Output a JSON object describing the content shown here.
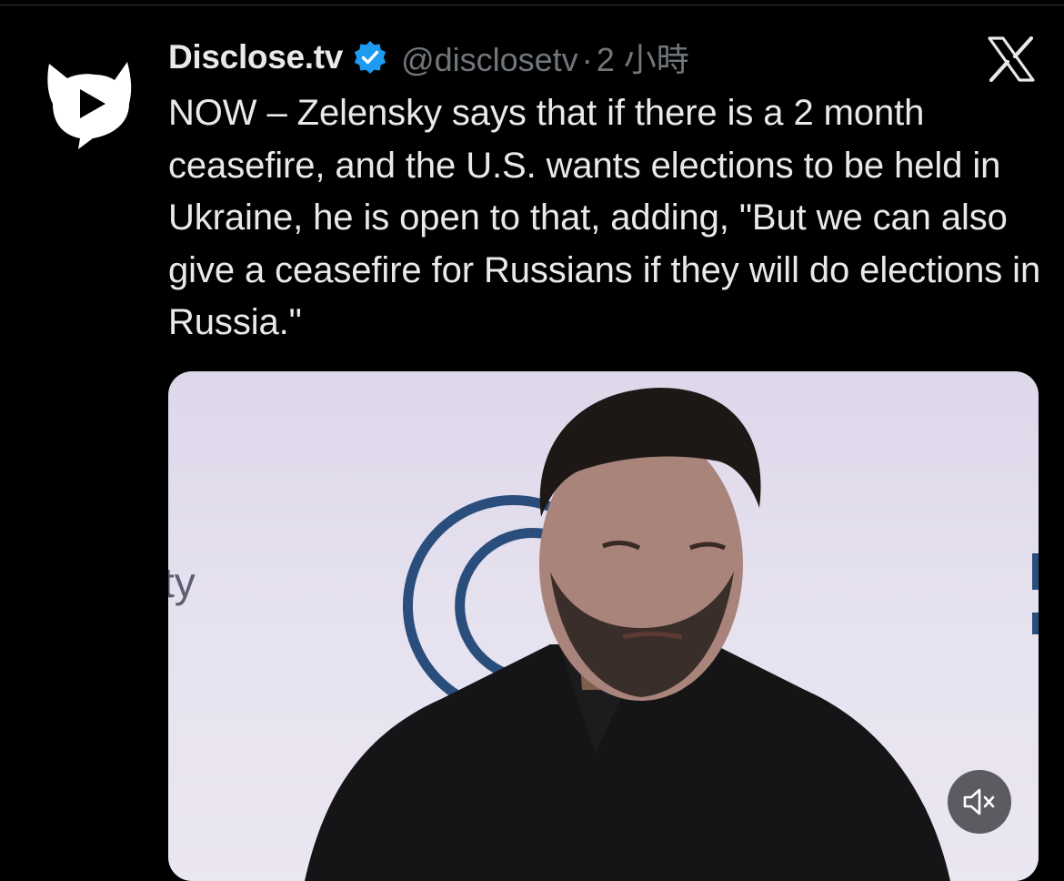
{
  "tweet": {
    "display_name": "Disclose.tv",
    "handle": "@disclosetv",
    "separator": "·",
    "time": "2 小時",
    "text": "NOW – Zelensky says that if there is a 2 month ceasefire, and the U.S. wants elections to be held in Ukraine, he is open to that, adding, \"But we can also give a ceasefire for Russians if they will do elections in Russia.\""
  },
  "media": {
    "backdrop_text": "ty"
  },
  "icons": {
    "avatar": "disclose-tv-logo",
    "verified": "verified-badge-icon",
    "platform": "x-logo-icon",
    "mute": "volume-muted-icon"
  },
  "colors": {
    "background": "#000000",
    "text": "#e7e9ea",
    "secondary_text": "#71767b",
    "verified_blue": "#1d9bf0"
  }
}
